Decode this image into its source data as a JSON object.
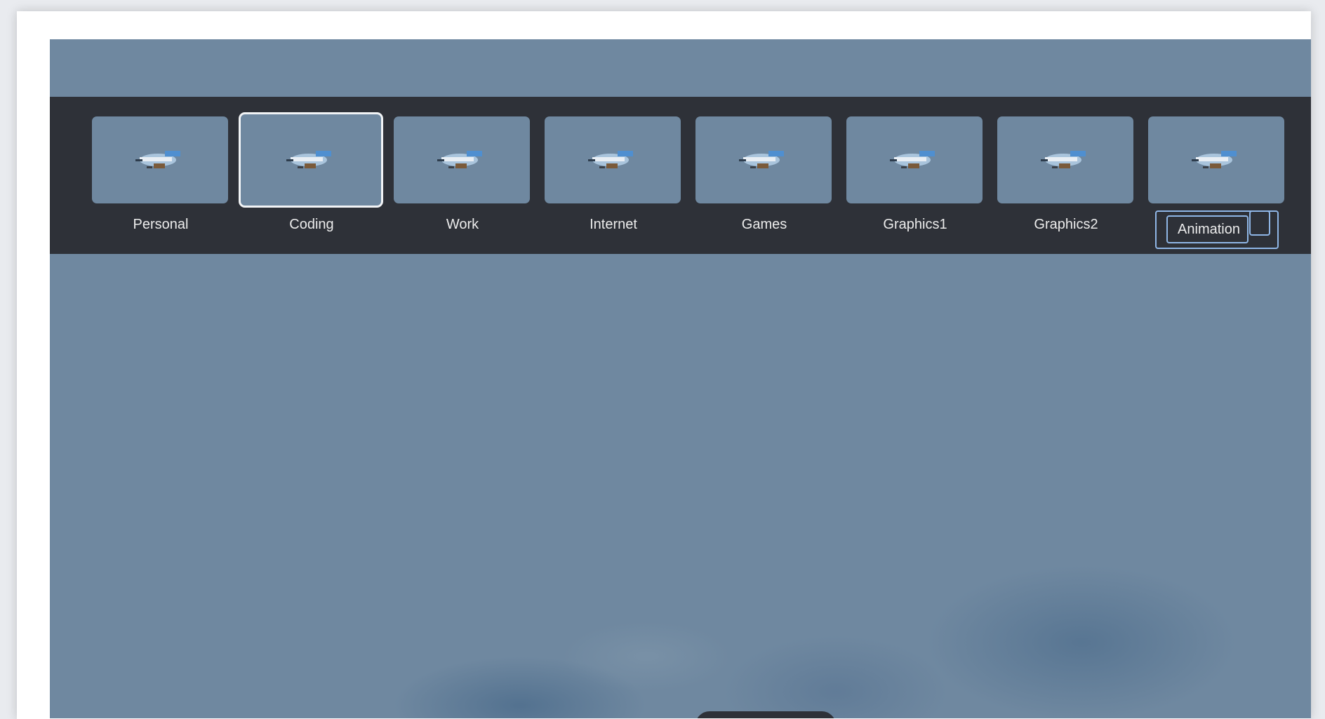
{
  "workspaces": {
    "items": [
      {
        "label": "Personal",
        "icon": "wallpaper-thumbnail"
      },
      {
        "label": "Coding",
        "icon": "wallpaper-thumbnail",
        "selected": true
      },
      {
        "label": "Work",
        "icon": "wallpaper-thumbnail"
      },
      {
        "label": "Internet",
        "icon": "wallpaper-thumbnail"
      },
      {
        "label": "Games",
        "icon": "wallpaper-thumbnail"
      },
      {
        "label": "Graphics1",
        "icon": "wallpaper-thumbnail"
      },
      {
        "label": "Graphics2",
        "icon": "wallpaper-thumbnail"
      },
      {
        "label": "Animation",
        "icon": "wallpaper-thumbnail",
        "editing": true
      }
    ]
  },
  "colors": {
    "bar": "#2e3138",
    "desktop": "#6f88a0",
    "selection_border": "#f2f4f6",
    "edit_border": "#8fb6e6"
  }
}
